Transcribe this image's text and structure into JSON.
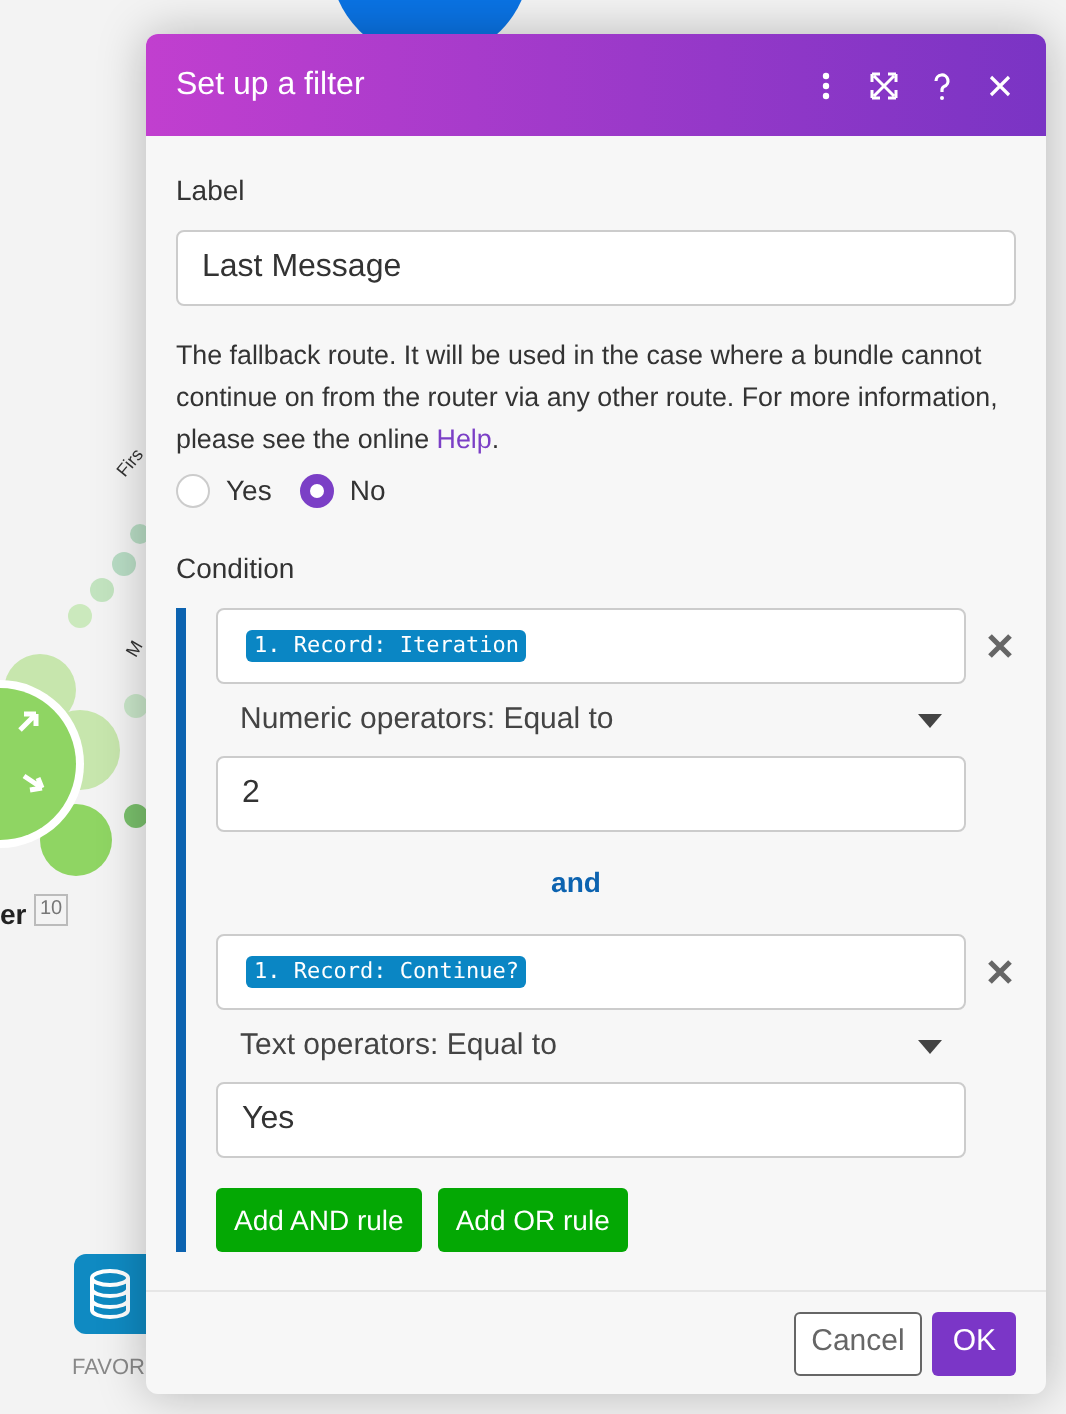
{
  "canvas": {
    "route_labels": [
      "Firs",
      "M"
    ],
    "node_label": "er",
    "node_badge": "10",
    "favorites_label": "FAVOR"
  },
  "dialog": {
    "title": "Set up a filter",
    "label_field": {
      "label": "Label",
      "value": "Last Message"
    },
    "fallback": {
      "text": "The fallback route. It will be used in the case where a bundle cannot continue on from the router via any other route. For more information, please see the online ",
      "link": "Help",
      "after": "."
    },
    "fallback_options": [
      {
        "label": "Yes",
        "selected": false
      },
      {
        "label": "No",
        "selected": true
      }
    ],
    "condition_label": "Condition",
    "rules": [
      {
        "operand": "1. Record: Iteration",
        "operator": "Numeric operators: Equal to",
        "value": "2"
      },
      {
        "operand": "1. Record: Continue?",
        "operator": "Text operators: Equal to",
        "value": "Yes"
      }
    ],
    "connector": "and",
    "rule_buttons": [
      "Add AND rule",
      "Add OR rule"
    ],
    "footer_buttons": [
      {
        "label": "Cancel",
        "kind": "secondary"
      },
      {
        "label": "OK",
        "kind": "primary"
      }
    ]
  }
}
